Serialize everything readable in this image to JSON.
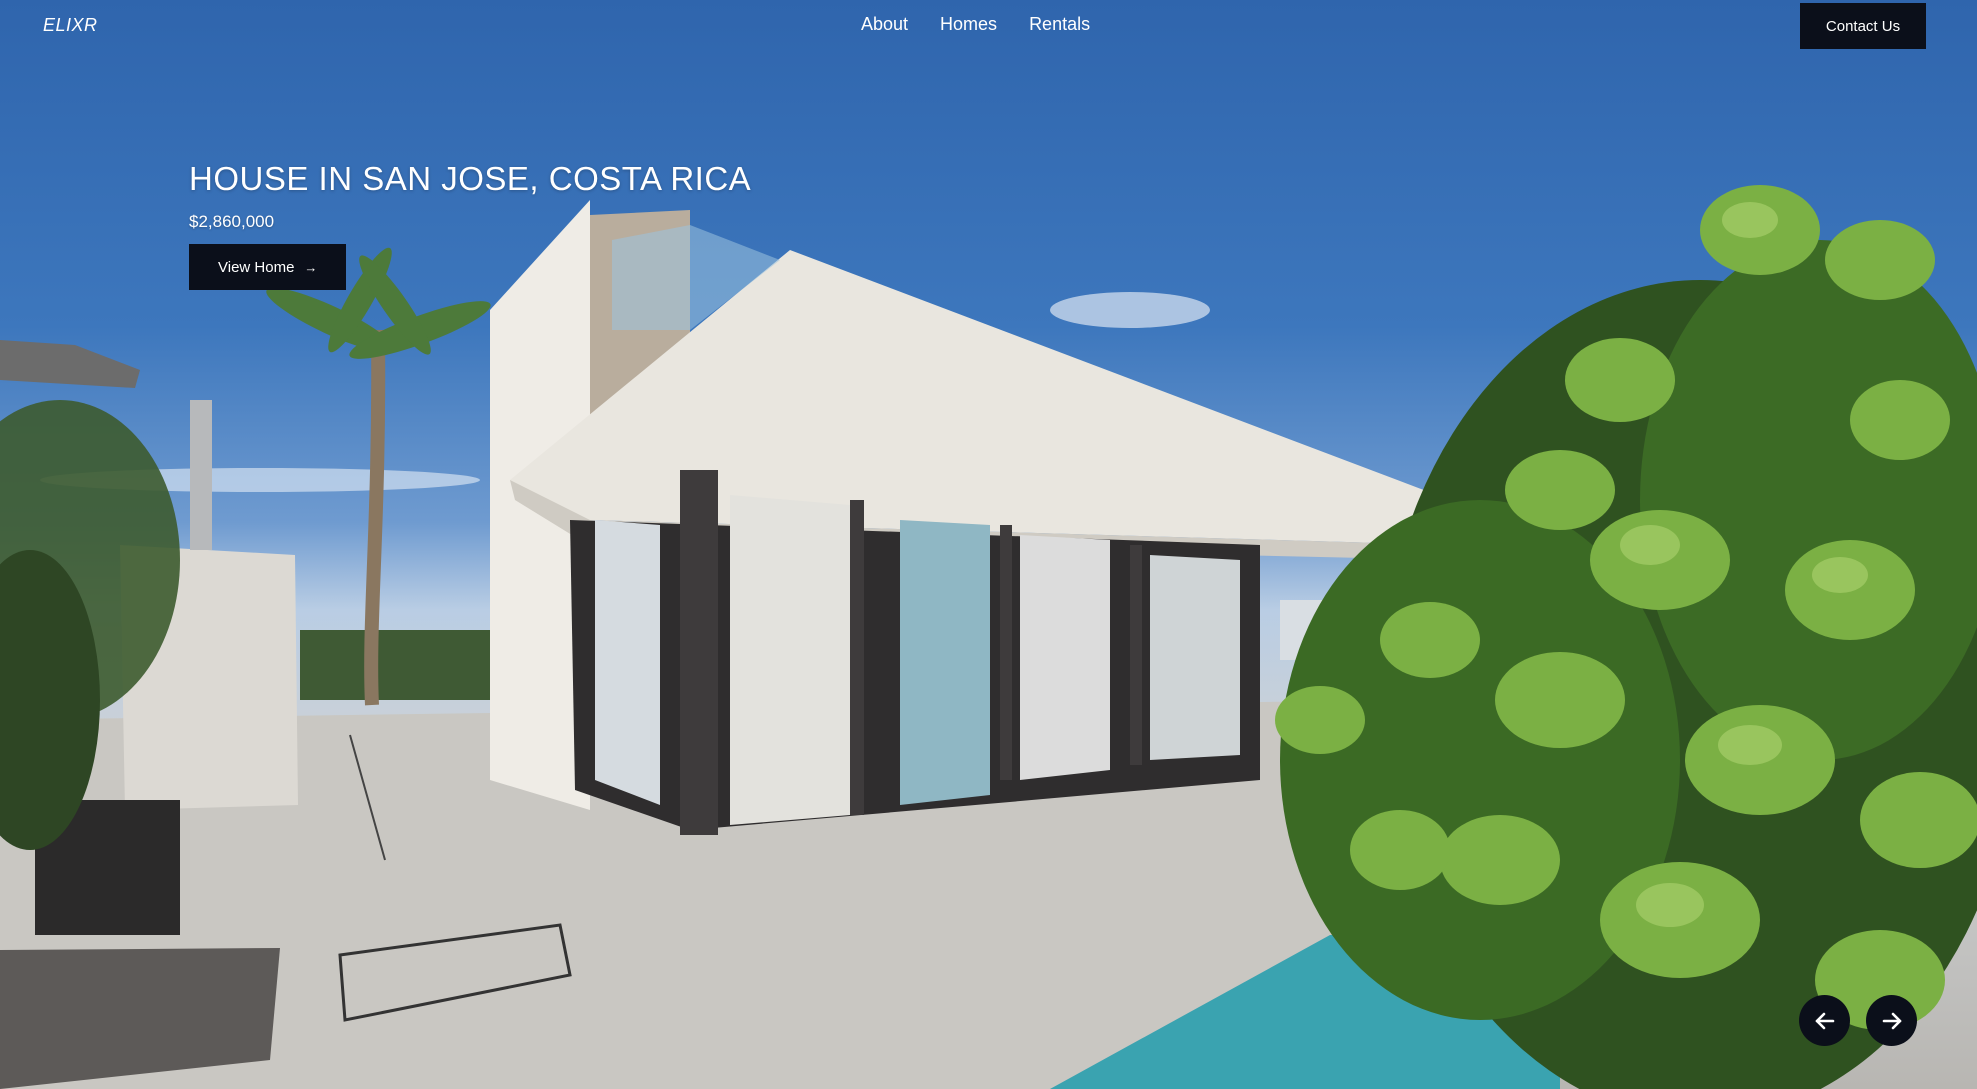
{
  "brand": {
    "name": "ELIXR"
  },
  "nav": {
    "items": [
      {
        "label": "About"
      },
      {
        "label": "Homes"
      },
      {
        "label": "Rentals"
      }
    ],
    "contact_label": "Contact Us"
  },
  "hero": {
    "title": "HOUSE IN SAN JOSE, COSTA RICA",
    "price": "$2,860,000",
    "cta_label": "View Home",
    "cta_icon": "arrow-right-icon",
    "background_image": "modern-white-villa-with-pool-and-palm-trees"
  },
  "carousel": {
    "prev_icon": "arrow-left-icon",
    "next_icon": "arrow-right-icon"
  },
  "colors": {
    "button_bg": "#0b0f1a",
    "text": "#ffffff",
    "sky": "#3d77bd"
  }
}
